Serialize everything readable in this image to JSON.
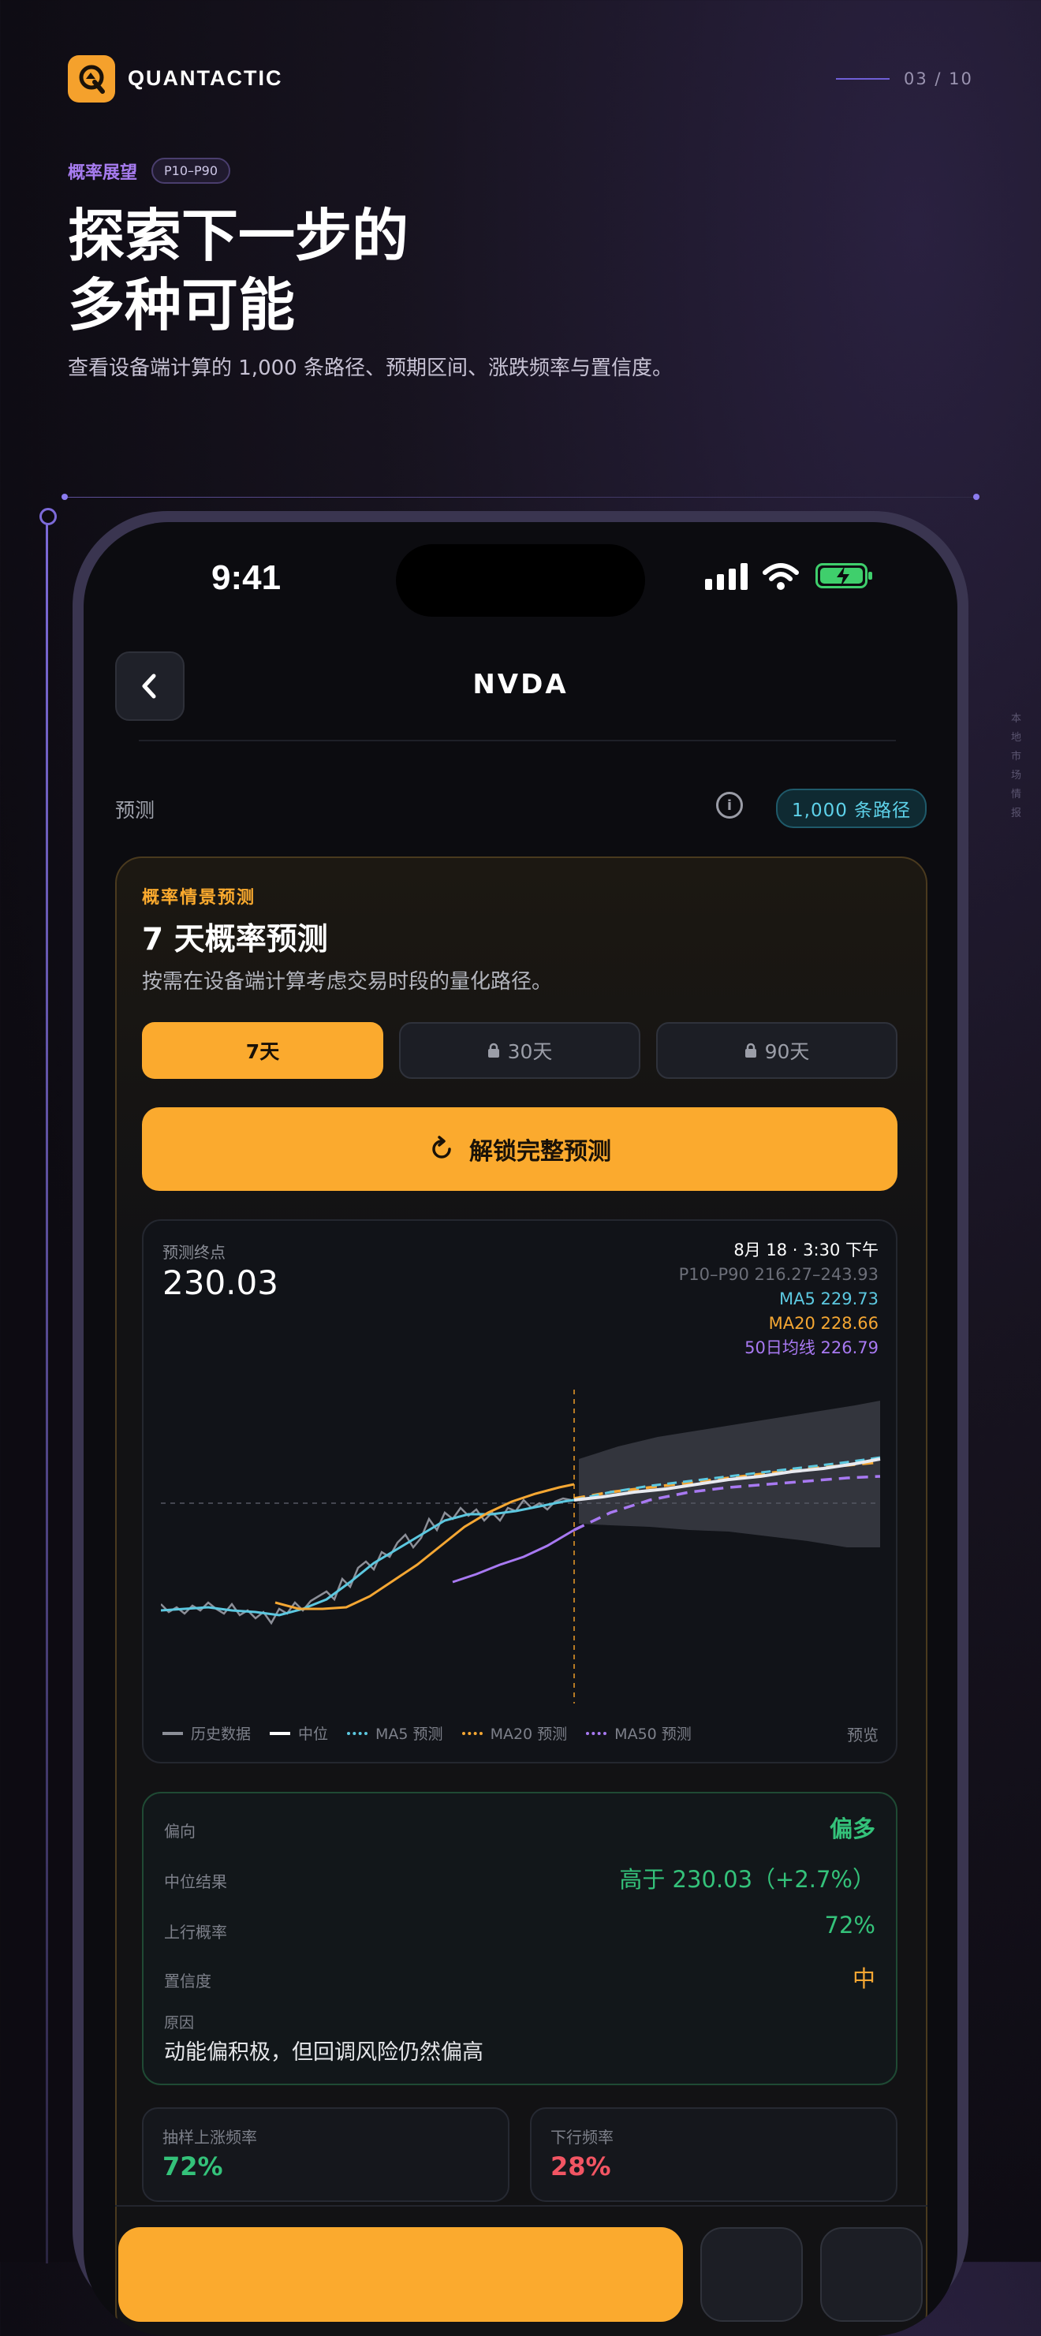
{
  "brand": {
    "name": "QUANTACTIC",
    "pager": "03 / 10"
  },
  "hero": {
    "kicker": "概率展望",
    "kicker_badge": "P10–P90",
    "title": "探索下一步的多种可能",
    "title_line1": "探索下一步的",
    "title_line2": "多种可能",
    "subtitle": "查看设备端计算的 1,000 条路径、预期区间、涨跌频率与置信度。",
    "side_note": "本地市场情报"
  },
  "status": {
    "time": "9:41"
  },
  "nav": {
    "title": "NVDA"
  },
  "forecast_row": {
    "label": "预测",
    "paths_badge": "1,000 条路径"
  },
  "card": {
    "kicker": "概率情景预测",
    "title": "7 天概率预测",
    "desc": "按需在设备端计算考虑交易时段的量化路径。",
    "tabs": [
      {
        "label": "7天",
        "locked": false
      },
      {
        "label": "30天",
        "locked": true
      },
      {
        "label": "90天",
        "locked": true
      }
    ],
    "unlock_label": "解锁完整预测"
  },
  "chart": {
    "end_label": "预测终点",
    "end_value": "230.03",
    "date": "8月 18 · 3:30 下午",
    "range": "P10–P90 216.27–243.93",
    "ma5": "MA5 229.73",
    "ma20": "MA20 228.66",
    "ma50": "50日均线 226.79",
    "legend": [
      "历史数据",
      "中位",
      "MA5 预测",
      "MA20 预测",
      "MA50 预测"
    ],
    "preview": "预览"
  },
  "summary": {
    "rows": [
      {
        "k": "偏向",
        "v": "偏多"
      },
      {
        "k": "中位结果",
        "v": "高于 230.03（+2.7%）"
      },
      {
        "k": "上行概率",
        "v": "72%"
      },
      {
        "k": "置信度",
        "v": "中"
      }
    ],
    "reason_label": "原因",
    "reason": "动能偏积极，但回调风险仍然偏高"
  },
  "freq": {
    "up_label": "抽样上涨频率",
    "up": "72%",
    "down_label": "下行频率",
    "down": "28%"
  },
  "colors": {
    "accent": "#fbaa2e",
    "up": "#34c27a",
    "down": "#f25563",
    "ma5": "#5cc8e0",
    "ma20": "#f5a733",
    "ma50": "#a879f2"
  }
}
